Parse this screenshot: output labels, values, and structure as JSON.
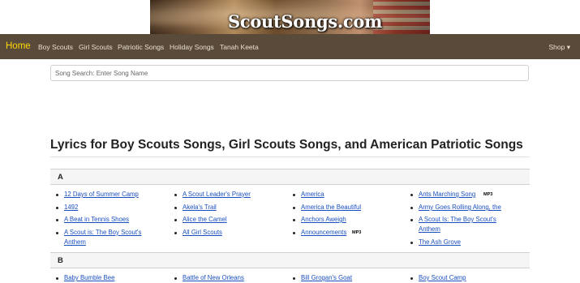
{
  "banner": {
    "logo": "ScoutSongs.com"
  },
  "nav": {
    "home": "Home",
    "items": [
      "Boy Scouts",
      "Girl Scouts",
      "Patriotic Songs",
      "Holiday Songs",
      "Tanah Keeta"
    ],
    "shop": "Shop ▾"
  },
  "search": {
    "placeholder": "Song Search: Enter Song Name"
  },
  "page_title": "Lyrics for Boy Scouts Songs, Girl Scouts Songs, and American Patriotic Songs",
  "sections": [
    {
      "letter": "A",
      "columns": [
        [
          "12 Days of Summer Camp",
          "1492",
          "A Beat in Tennis Shoes",
          "A Scout is: The Boy Scout's Anthem"
        ],
        [
          "A Scout Leader's Prayer",
          "Akela's Trail",
          "Alice the Camel",
          "All Girl Scouts"
        ],
        [
          "America",
          "America the Beautiful",
          "Anchors Aweigh",
          "Announcements"
        ],
        [
          "Ants Marching Song",
          "Army Goes Rolling Along, the",
          "A Scout Is: The Boy Scout's Anthem",
          "The Ash Grove"
        ]
      ],
      "mp3_badge": "MP3"
    },
    {
      "letter": "B",
      "columns": [
        [
          "Baby Bumble Bee"
        ],
        [
          "Battle of New Orleans"
        ],
        [
          "Bill Grogan's Goat"
        ],
        [
          "Boy Scout Camp"
        ]
      ]
    }
  ]
}
